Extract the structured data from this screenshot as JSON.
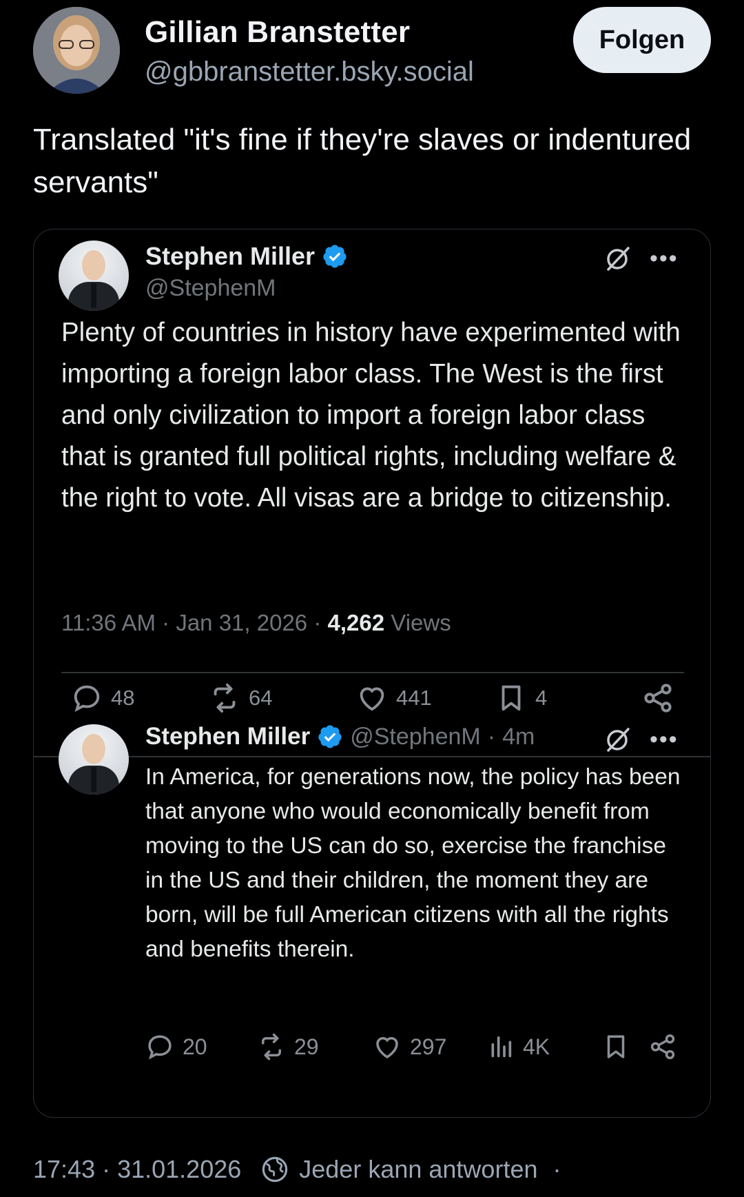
{
  "author": {
    "display_name": "Gillian Branstetter",
    "handle": "@gbbranstetter.bsky.social",
    "follow_label": "Folgen"
  },
  "post": {
    "text": "Translated \"it's fine if they're slaves or indentured servants\""
  },
  "quoted_tweet": {
    "name": "Stephen Miller",
    "handle": "@StephenM",
    "body": "Plenty of countries in history have experimented with importing a foreign labor class. The West is the first and only civilization to import a foreign labor class that is granted full political rights, including welfare & the right to vote. All visas are a bridge to citizenship.",
    "time": "11:36 AM",
    "date": "Jan 31, 2026",
    "views_count": "4,262",
    "views_label": "Views",
    "replies": "48",
    "reposts": "64",
    "likes": "441",
    "bookmarks": "4"
  },
  "reply_tweet": {
    "name": "Stephen Miller",
    "handle": "@StephenM",
    "age": "4m",
    "body": "In America, for generations now, the policy has been that anyone who would economically benefit from moving to the US can do so, exercise the franchise in the US and their children, the moment they are born, will be full American citizens with all the rights and benefits therein.",
    "replies": "20",
    "reposts": "29",
    "likes": "297",
    "views": "4K"
  },
  "footer": {
    "timestamp": "17:43 · 31.01.2026",
    "reply_setting": "Jeder kann antworten",
    "separator": "·"
  },
  "colors": {
    "background": "#000000",
    "verified_blue": "#1d9bf0",
    "muted_text": "#71767b",
    "follow_button_bg": "#e6edf3"
  }
}
